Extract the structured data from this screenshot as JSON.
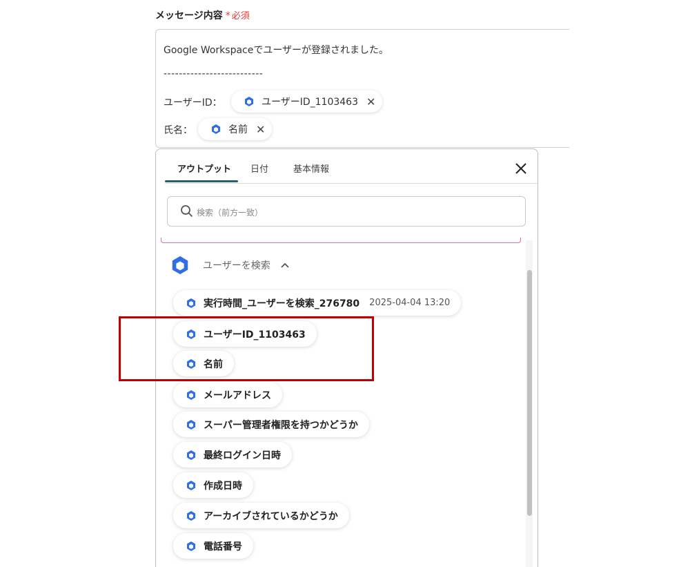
{
  "field": {
    "label": "メッセージ内容",
    "required_mark": "*",
    "required_text": "必須"
  },
  "message": {
    "line1": "Google Workspaceでユーザーが登録されました。",
    "line2": "--------------------------",
    "user_id_label": "ユーザーID：",
    "user_id_token": "ユーザーID_1103463",
    "name_label": "氏名：",
    "name_token": "名前"
  },
  "panel": {
    "tabs": [
      {
        "label": "アウトプット",
        "active": true
      },
      {
        "label": "日付",
        "active": false
      },
      {
        "label": "基本情報",
        "active": false
      }
    ],
    "search_placeholder": "検索（前方一致）",
    "group_label": "ユーザーを検索",
    "items": [
      {
        "label": "実行時間_ユーザーを検索_276780",
        "timestamp": "2025-04-04 13:20"
      },
      {
        "label": "ユーザーID_1103463"
      },
      {
        "label": "名前"
      },
      {
        "label": "メールアドレス"
      },
      {
        "label": "スーパー管理者権限を持つかどうか"
      },
      {
        "label": "最終ログイン日時"
      },
      {
        "label": "作成日時"
      },
      {
        "label": "アーカイブされているかどうか"
      },
      {
        "label": "電話番号"
      }
    ]
  },
  "colors": {
    "required": "#e53935",
    "tab_underline": "#1f5f79",
    "icon_blue": "#2f6fe0",
    "highlight": "#c00000",
    "search_border_pink": "#ef6b9c"
  },
  "icons": {
    "item": "google-workspace-hexagon-icon",
    "close": "close-icon",
    "search": "search-icon",
    "caret": "chevron-up-icon"
  }
}
